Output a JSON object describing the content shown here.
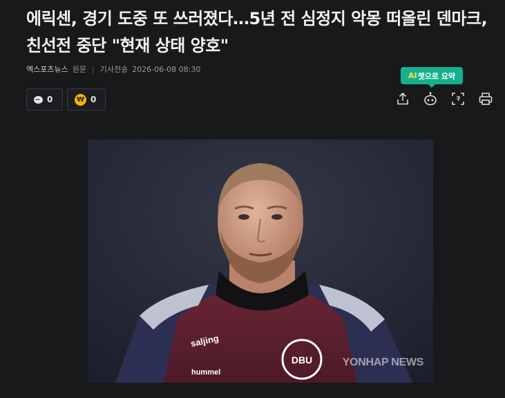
{
  "article": {
    "headline": "에릭센, 경기 도중 또 쓰러졌다…5년 전 심정지 악몽 떠올린 덴마크, 친선전 중단 \"현재 상태 양호\"",
    "source": "엑스포츠뉴스",
    "source_type": "원문",
    "timestamp_label": "기사전송",
    "timestamp": "2026-06-08 08:30"
  },
  "reactions": {
    "comment_count": "0",
    "like_count": "0",
    "coin_glyph": "₩"
  },
  "tools": {
    "ai_tag": {
      "prefix": "AI",
      "text": "챗으로 요약"
    },
    "icons": [
      "share-icon",
      "ai-summary-bot-icon",
      "text-size-icon",
      "print-icon"
    ]
  },
  "photo": {
    "credit": "YONHAP NEWS",
    "jersey_brand": "hummel",
    "sponsor": "saljing",
    "badge": "DBU"
  },
  "colors": {
    "background": "#18191b",
    "ai_tag": "#16b08f",
    "ai_prefix": "#ffe25a",
    "coin": "#f2b705"
  }
}
